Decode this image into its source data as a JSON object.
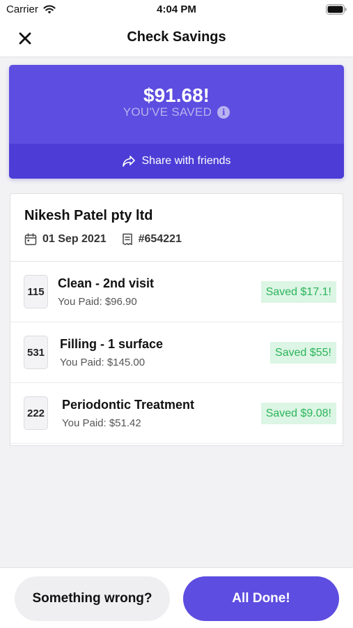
{
  "status_bar": {
    "carrier": "Carrier",
    "time": "4:04 PM"
  },
  "nav": {
    "title": "Check Savings",
    "close_icon": "close-icon"
  },
  "savings": {
    "amount": "$91.68!",
    "label": "YOU'VE SAVED",
    "info_icon": "i",
    "share_label": "Share with friends"
  },
  "receipt": {
    "provider": "Nikesh Patel pty ltd",
    "date": "01 Sep 2021",
    "number": "#654221",
    "items": [
      {
        "code": "115",
        "name": "Clean - 2nd visit",
        "paid": "You Paid: $96.90",
        "saved": "Saved $17.1!"
      },
      {
        "code": "531",
        "name": "Filling - 1 surface",
        "paid": "You Paid: $145.00",
        "saved": "Saved $55!"
      },
      {
        "code": "222",
        "name": "Periodontic Treatment",
        "paid": "You Paid: $51.42",
        "saved": "Saved $9.08!"
      }
    ]
  },
  "actions": {
    "wrong_label": "Something wrong?",
    "done_label": "All Done!"
  },
  "colors": {
    "accent": "#5d4de0",
    "accent_dark": "#4d3dd6",
    "saved_green": "#2bb45a",
    "saved_bg": "#dcf5e4"
  }
}
